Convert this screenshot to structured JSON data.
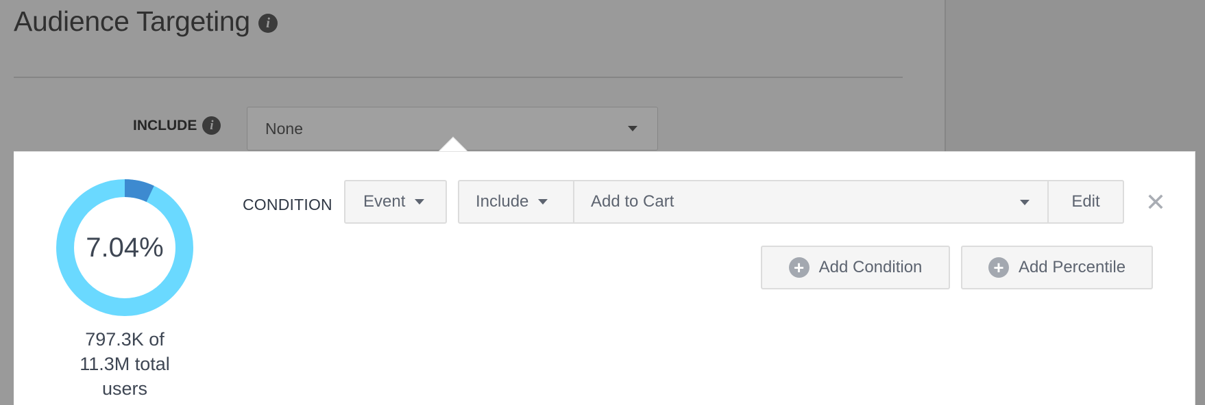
{
  "page": {
    "title": "Audience Targeting",
    "title_info_icon": "info-icon",
    "include_label": "INCLUDE",
    "include_info_icon": "info-icon",
    "include_value": "None"
  },
  "panel": {
    "reach": {
      "percent": "7.04%",
      "percent_value": 7.04,
      "reached": "797.3K of",
      "total": "11.3M total",
      "unit": "users",
      "colors": {
        "filled": "#3d8ad0",
        "remaining": "#6ad9ff"
      }
    },
    "condition_label": "CONDITION",
    "type_button": "Event",
    "mode_button": "Include",
    "event_select": "Add to Cart",
    "edit_button": "Edit",
    "close_icon": "close-icon",
    "add_condition_button": "Add Condition",
    "add_percentile_button": "Add Percentile",
    "plus_icon": "plus-circle-icon"
  }
}
